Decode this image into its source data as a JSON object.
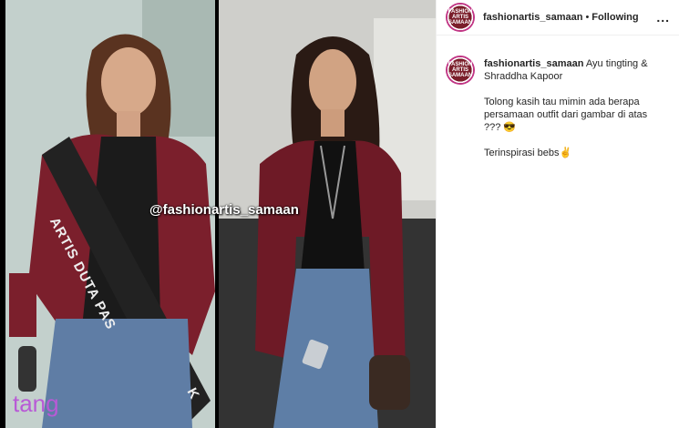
{
  "post": {
    "watermark": "@fashionartis_samaan",
    "corner_logo": "tang",
    "sash_text": "ARTIS DUTA PAS",
    "sash_tail": "K"
  },
  "header": {
    "avatar_text": "FASHION ARTIS SAMAAN",
    "username": "fashionartis_samaan",
    "separator": "•",
    "follow_state": "Following",
    "more": "..."
  },
  "caption": {
    "username": "fashionartis_samaan",
    "line1": "Ayu tingting & Shraddha Kapoor",
    "line2": "Tolong kasih tau mimin ada berapa persamaan outfit dari gambar di atas ??? 😎",
    "line3": "Terinspirasi bebs✌"
  }
}
